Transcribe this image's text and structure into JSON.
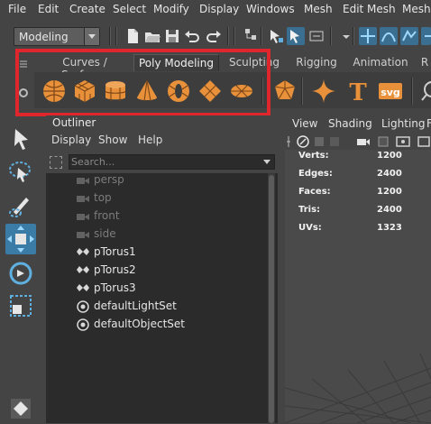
{
  "menubar": {
    "items": [
      "File",
      "Edit",
      "Create",
      "Select",
      "Modify",
      "Display",
      "Windows",
      "Mesh",
      "Edit Mesh",
      "Mesh T"
    ]
  },
  "statusline": {
    "mode": "Modeling",
    "icons": [
      "new-scene-icon",
      "open-scene-icon",
      "save-scene-icon",
      "undo-icon",
      "redo-icon",
      "select-hierarchy-icon",
      "select-object-icon",
      "select-component-icon",
      "snap-grid-icon",
      "snap-curve-icon",
      "snap-point-icon"
    ]
  },
  "shelf": {
    "tabs": [
      "Curves / Surfaces",
      "Poly Modeling",
      "Sculpting",
      "Rigging",
      "Animation",
      "R"
    ],
    "active_tab": "Poly Modeling",
    "icons": [
      "poly-sphere-icon",
      "poly-cube-icon",
      "poly-cylinder-icon",
      "poly-cone-icon",
      "poly-torus-icon",
      "poly-plane-icon",
      "poly-disc-icon",
      "platonic-solid-icon",
      "super-shape-icon",
      "type-tool-icon",
      "svg-tool-icon"
    ],
    "svg_label": "svg",
    "type_label": "T",
    "highlight_color": "#e0262d",
    "accent_color": "#e8913a"
  },
  "toolbox": {
    "tools": [
      "select-tool-icon",
      "lasso-select-icon",
      "paint-select-icon",
      "move-tool-icon",
      "rotate-tool-icon",
      "scale-tool-icon"
    ],
    "active": "move-tool-icon"
  },
  "outliner": {
    "title": "Outliner",
    "menu": [
      "Display",
      "Show",
      "Help"
    ],
    "search_placeholder": "Search...",
    "items": [
      {
        "label": "persp",
        "kind": "camera"
      },
      {
        "label": "top",
        "kind": "camera"
      },
      {
        "label": "front",
        "kind": "camera"
      },
      {
        "label": "side",
        "kind": "camera"
      },
      {
        "label": "pTorus1",
        "kind": "mesh"
      },
      {
        "label": "pTorus2",
        "kind": "mesh"
      },
      {
        "label": "pTorus3",
        "kind": "mesh"
      },
      {
        "label": "defaultLightSet",
        "kind": "set"
      },
      {
        "label": "defaultObjectSet",
        "kind": "set"
      }
    ]
  },
  "viewport": {
    "menu": [
      "View",
      "Shading",
      "Lighting",
      "F"
    ],
    "hud": [
      {
        "key": "Verts:",
        "value": "1200"
      },
      {
        "key": "Edges:",
        "value": "2400"
      },
      {
        "key": "Faces:",
        "value": "1200"
      },
      {
        "key": "Tris:",
        "value": "2400"
      },
      {
        "key": "UVs:",
        "value": "1323"
      }
    ]
  }
}
